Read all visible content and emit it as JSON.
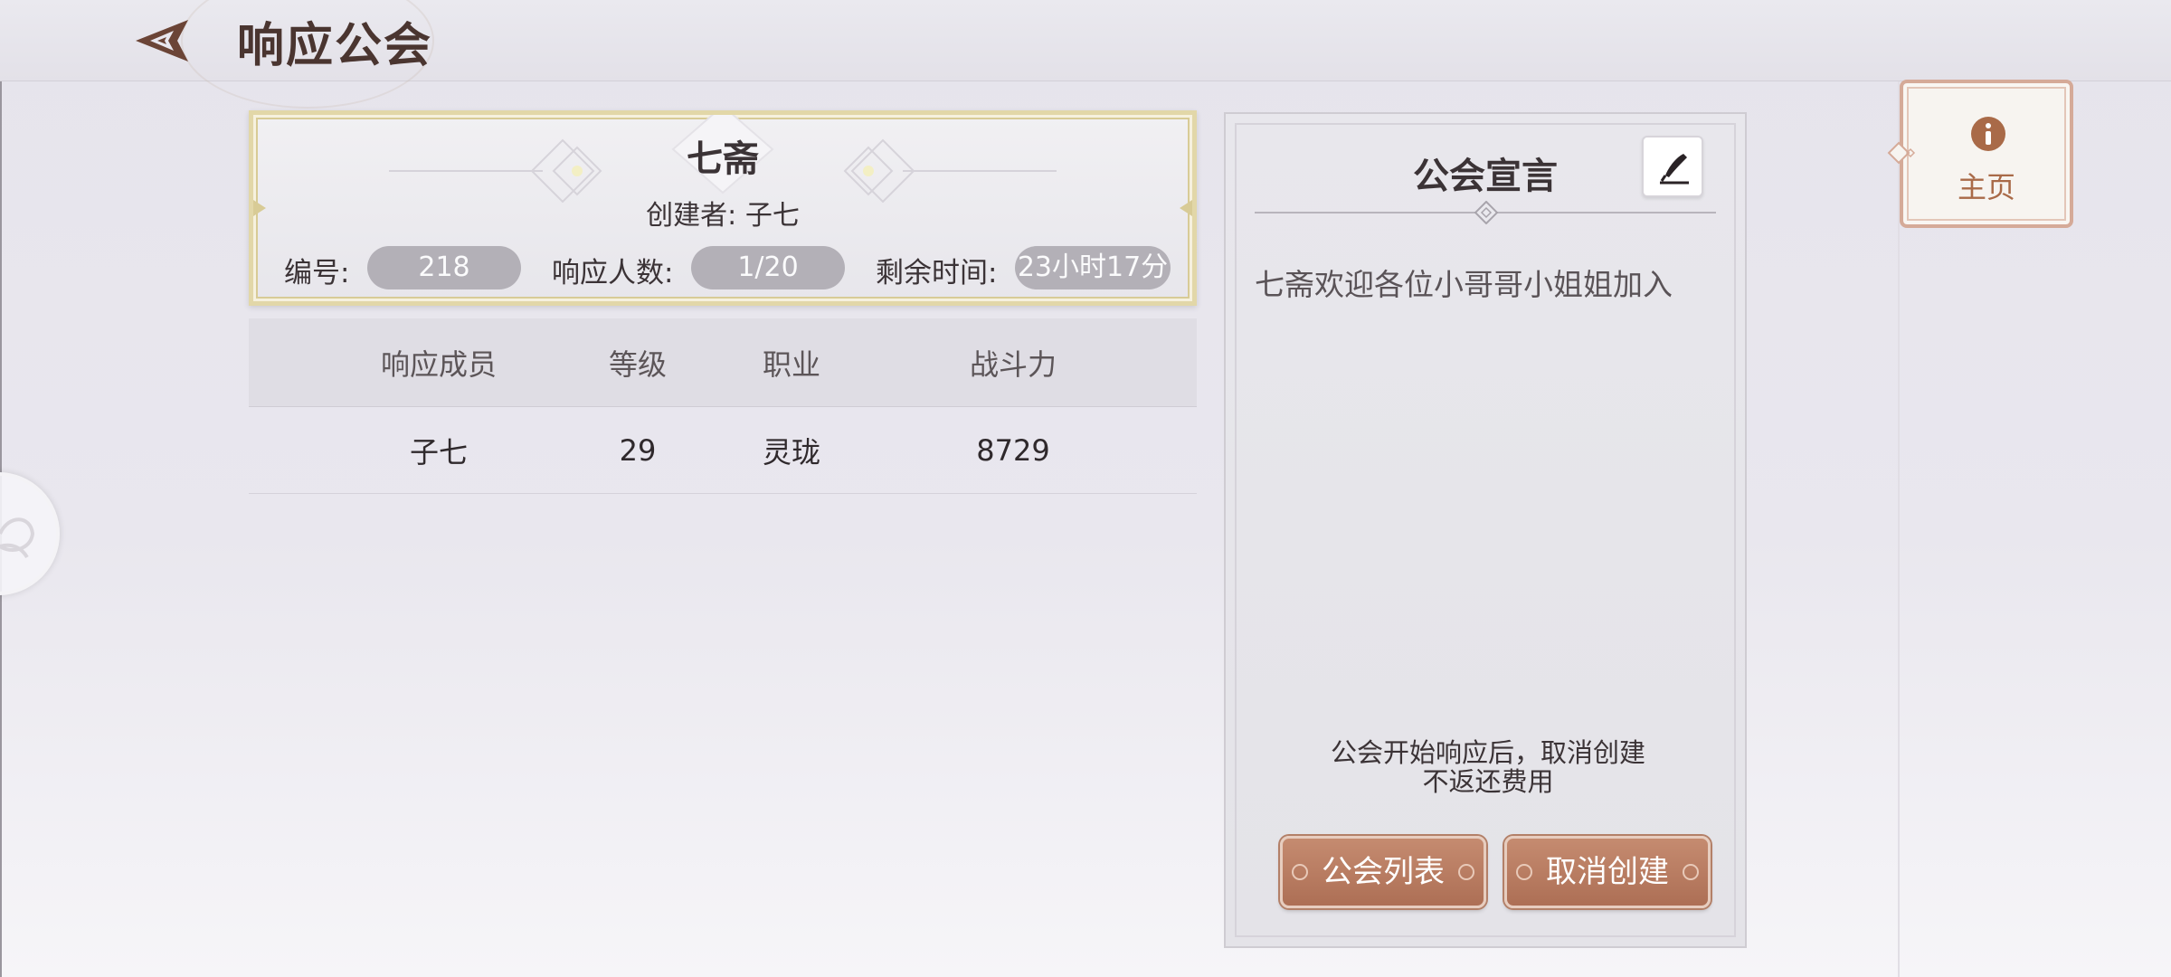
{
  "header": {
    "title": "响应公会"
  },
  "guild": {
    "name": "七斋",
    "creator_label": "创建者:",
    "creator_name": "子七",
    "id_label": "编号:",
    "id_value": "218",
    "responders_label": "响应人数:",
    "responders_value": "1/20",
    "time_label": "剩余时间:",
    "time_value": "23小时17分"
  },
  "table": {
    "columns": [
      "响应成员",
      "等级",
      "职业",
      "战斗力"
    ],
    "rows": [
      {
        "name": "子七",
        "level": "29",
        "class": "灵珑",
        "power": "8729"
      }
    ]
  },
  "manifesto": {
    "title": "公会宣言",
    "text": "七斋欢迎各位小哥哥小姐姐加入",
    "notice": "公会开始响应后，取消创建不返还费用",
    "list_button": "公会列表",
    "cancel_button": "取消创建"
  },
  "side_tab": {
    "label": "主页",
    "icon": "info-icon"
  },
  "colors": {
    "accent_copper": "#ad6f55",
    "pill_gray": "#b3b0b7",
    "gold_border": "#e2d7a8",
    "tab_text": "#a96a48"
  }
}
